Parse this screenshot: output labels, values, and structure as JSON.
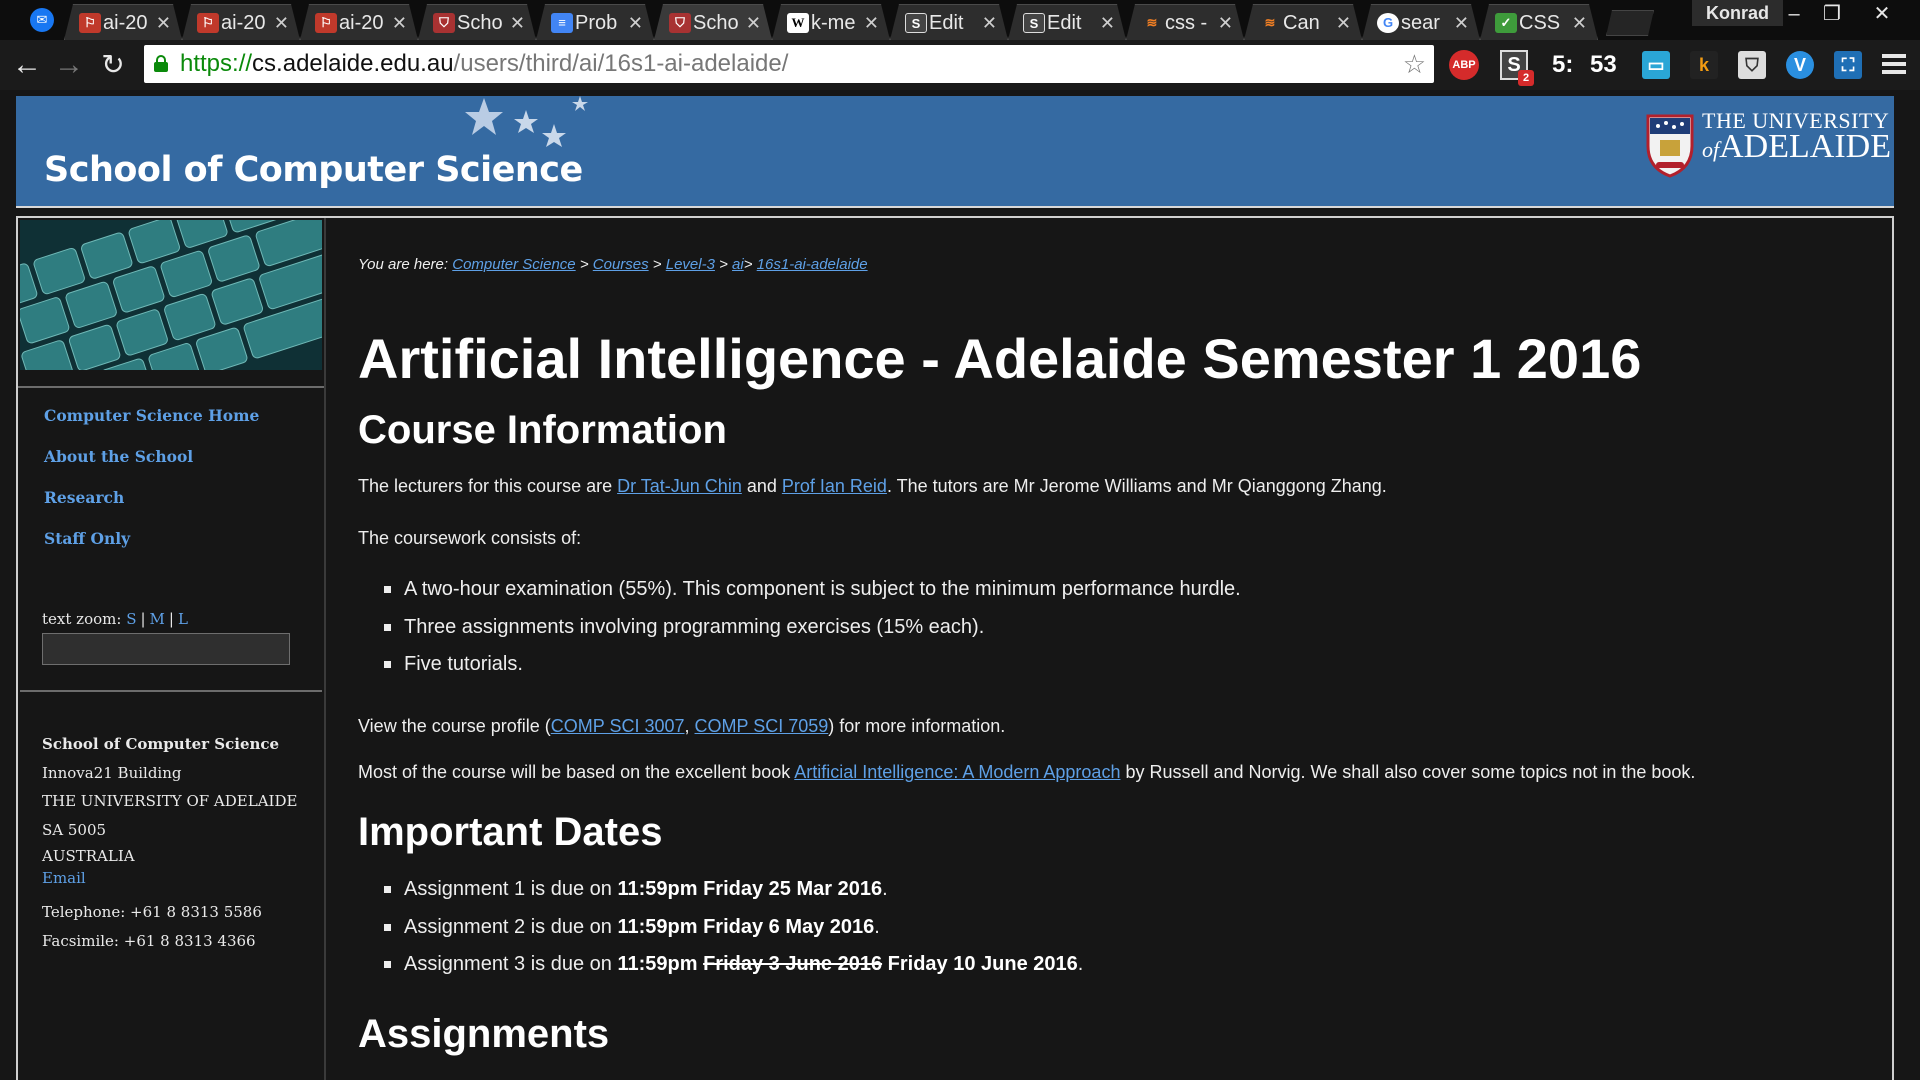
{
  "browser": {
    "tabs": [
      {
        "label": "ai-20",
        "favicon": "pdf-icon",
        "active": false
      },
      {
        "label": "ai-20",
        "favicon": "pdf-icon",
        "active": false
      },
      {
        "label": "ai-20",
        "favicon": "pdf-icon",
        "active": false
      },
      {
        "label": "Scho",
        "favicon": "shield-icon",
        "active": false
      },
      {
        "label": "Prob",
        "favicon": "docs-icon",
        "active": false
      },
      {
        "label": "Scho",
        "favicon": "shield-icon",
        "active": true
      },
      {
        "label": "k-me",
        "favicon": "wikipedia-icon",
        "active": false
      },
      {
        "label": "Edit",
        "favicon": "s-icon",
        "active": false
      },
      {
        "label": "Edit",
        "favicon": "s-icon",
        "active": false
      },
      {
        "label": "css -",
        "favicon": "stackoverflow-icon",
        "active": false
      },
      {
        "label": "Can",
        "favicon": "stackoverflow-icon",
        "active": false
      },
      {
        "label": "sear",
        "favicon": "google-icon",
        "active": false
      },
      {
        "label": "CSS",
        "favicon": "caniuse-icon",
        "active": false
      }
    ],
    "profile_name": "Konrad",
    "url": {
      "protocol": "https://",
      "host": "cs.adelaide.edu.au",
      "path": "/users/third/ai/16s1-ai-adelaide/"
    },
    "extensions": {
      "abp_label": "ABP",
      "s_label": "S",
      "s_badge": "2",
      "timer_minutes": "5:",
      "timer_seconds": "53",
      "k_label": "k",
      "v_label": "V"
    },
    "colors": {
      "abp": "#d52b2b",
      "docs": "#4285f4",
      "caniuse": "#3e9b3b"
    }
  },
  "banner": {
    "school_title": "School of Computer Science",
    "university_line1": "THE UNIVERSITY",
    "university_of": "of",
    "university_line2": "ADELAIDE"
  },
  "sidebar": {
    "nav": [
      {
        "label": "Computer Science Home"
      },
      {
        "label": "About the School"
      },
      {
        "label": "Research"
      },
      {
        "label": "Staff Only"
      }
    ],
    "zoom": {
      "label": "text zoom:",
      "small": "S",
      "medium": "M",
      "large": "L",
      "separator": "|"
    },
    "address": {
      "name": "School of Computer Science",
      "building": "Innova21 Building",
      "university": "THE UNIVERSITY OF ADELAIDE",
      "postcode": "SA 5005",
      "country": "AUSTRALIA",
      "email_label": "Email",
      "telephone": "Telephone: +61 8 8313 5586",
      "facsimile": "Facsimile: +61 8 8313 4366"
    }
  },
  "main": {
    "breadcrumb": {
      "prefix": "You are here:",
      "items": [
        "Computer Science",
        "Courses",
        "Level-3",
        "ai",
        "16s1-ai-adelaide"
      ],
      "separator": ">"
    },
    "title": "Artificial Intelligence - Adelaide Semester 1 2016",
    "course_info_heading": "Course Information",
    "lecturers": {
      "before": "The lecturers for this course are ",
      "lecturer1": "Dr Tat-Jun Chin",
      "middle": " and ",
      "lecturer2": "Prof Ian Reid",
      "after": ". The tutors are Mr Jerome Williams and Mr Qianggong Zhang."
    },
    "coursework_intro": "The coursework consists of:",
    "coursework_items": [
      "A two-hour examination (55%). This component is subject to the minimum performance hurdle.",
      "Three assignments involving programming exercises (15% each).",
      "Five tutorials."
    ],
    "profile": {
      "before": "View the course profile (",
      "link1": "COMP SCI 3007",
      "comma": ", ",
      "link2": "COMP SCI 7059",
      "after": ") for more information."
    },
    "book": {
      "before": "Most of the course will be based on the excellent book ",
      "link": "Artificial Intelligence: A Modern Approach",
      "after": " by Russell and Norvig. We shall also cover some topics not in the book."
    },
    "dates_heading": "Important Dates",
    "dates": [
      {
        "prefix": "Assignment 1 is due on ",
        "due": "11:59pm Friday 25 Mar 2016",
        "suffix": "."
      },
      {
        "prefix": "Assignment 2 is due on ",
        "due": "11:59pm Friday 6 May 2016",
        "suffix": "."
      },
      {
        "prefix": "Assignment 3 is due on ",
        "due_time": "11:59pm",
        "struck": "Friday 3 June 2016",
        "due": "Friday 10 June 2016",
        "suffix": "."
      }
    ],
    "assignments_heading": "Assignments"
  }
}
